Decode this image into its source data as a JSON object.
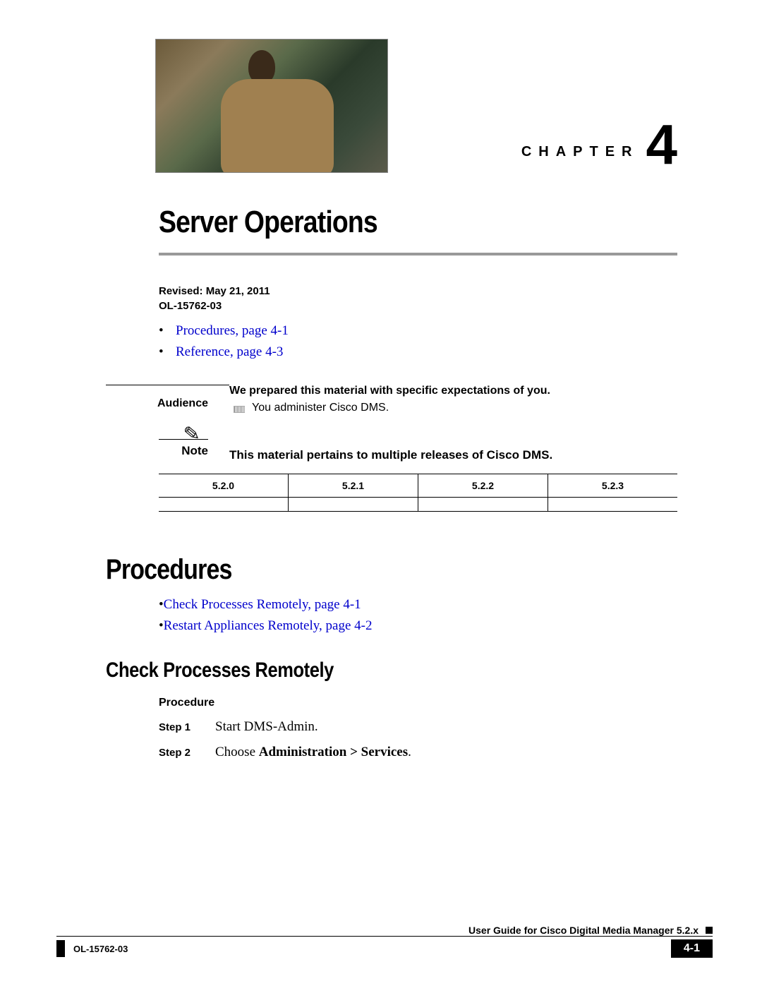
{
  "chapter": {
    "word": "CHAPTER",
    "number": "4"
  },
  "title": "Server Operations",
  "meta": {
    "revised": "Revised: May 21, 2011",
    "docid": "OL-15762-03"
  },
  "toc": [
    {
      "label": "Procedures, page 4-1"
    },
    {
      "label": "Reference, page 4-3"
    }
  ],
  "audience": {
    "label": "Audience",
    "lead": "We prepared this material with specific expectations of you.",
    "item": "You administer Cisco DMS."
  },
  "note": {
    "label": "Note",
    "text": "This material pertains to multiple releases of Cisco DMS."
  },
  "versions": [
    "5.2.0",
    "5.2.1",
    "5.2.2",
    "5.2.3"
  ],
  "procedures": {
    "heading": "Procedures",
    "toc": [
      {
        "label": "Check Processes Remotely, page 4-1"
      },
      {
        "label": "Restart Appliances Remotely, page 4-2"
      }
    ]
  },
  "subsection": {
    "heading": "Check Processes Remotely",
    "procLabel": "Procedure",
    "steps": [
      {
        "label": "Step 1",
        "plain": "Start DMS-Admin.",
        "bold": ""
      },
      {
        "label": "Step 2",
        "plain": "Choose ",
        "bold": "Administration > Services",
        "suffix": "."
      }
    ]
  },
  "footer": {
    "guide": "User Guide for Cisco Digital Media Manager 5.2.x",
    "docid": "OL-15762-03",
    "page": "4-1"
  }
}
